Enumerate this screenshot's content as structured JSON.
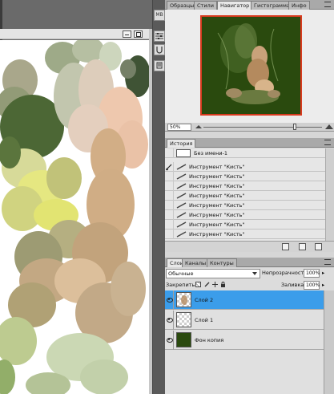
{
  "navigator_tabs": [
    "Образцы",
    "Стили",
    "Навигатор",
    "Гистограмма",
    "Инфо"
  ],
  "navigator_active": "Навигатор",
  "zoom": "50%",
  "history": {
    "tab": "История",
    "snapshot": "Без имени-1",
    "items": [
      "Инструмент \"Кисть\"",
      "Инструмент \"Кисть\"",
      "Инструмент \"Кисть\"",
      "Инструмент \"Кисть\"",
      "Инструмент \"Кисть\"",
      "Инструмент \"Кисть\"",
      "Инструмент \"Кисть\"",
      "Инструмент \"Кисть\""
    ]
  },
  "layers_panel": {
    "tabs": [
      "Слои",
      "Каналы",
      "Контуры"
    ],
    "blend_mode": "Обычные",
    "opacity_label": "Непрозрачность:",
    "opacity_value": "100%",
    "lock_label": "Закрепить:",
    "fill_label": "Заливка:",
    "fill_value": "100%",
    "layers": [
      {
        "name": "Слой 2",
        "selected": true
      },
      {
        "name": "Слой 1",
        "selected": false
      },
      {
        "name": "Фон копия",
        "selected": false
      }
    ]
  },
  "toolbar": {
    "mb_label": "MB"
  },
  "colors": {
    "accent_selected": "#3b9dea",
    "navigator_frame": "#d83a1e",
    "canvas_dark_green": "#2a4a0e"
  }
}
